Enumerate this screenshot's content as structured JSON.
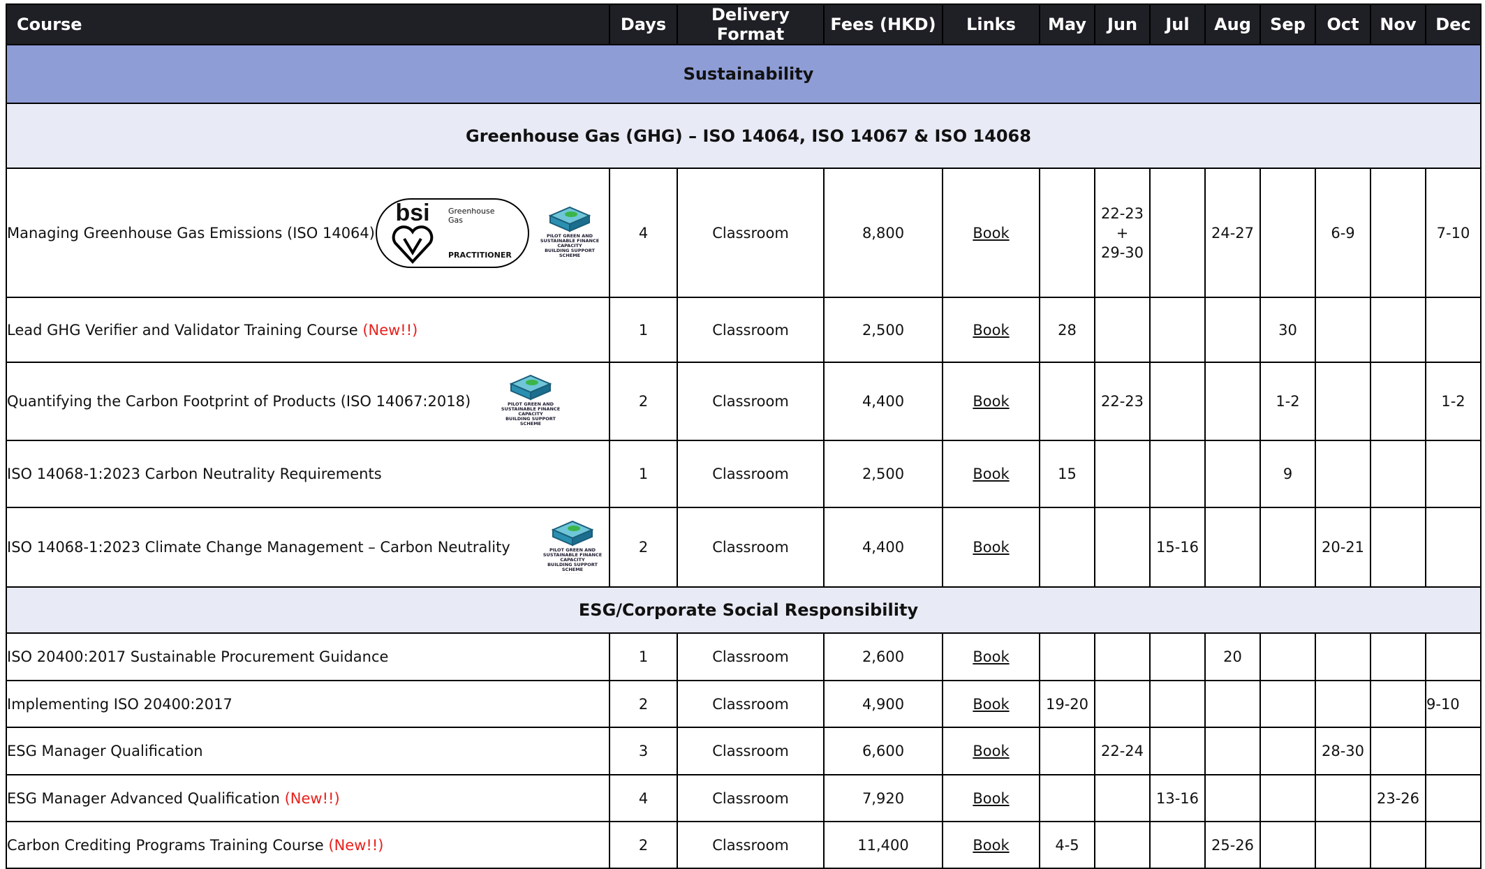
{
  "header": {
    "course": "Course",
    "days": "Days",
    "format": "Delivery Format",
    "fees": "Fees (HKD)",
    "links": "Links",
    "months": [
      "May",
      "Jun",
      "Jul",
      "Aug",
      "Sep",
      "Oct",
      "Nov",
      "Dec"
    ]
  },
  "section_title": "Sustainability",
  "subsection_ghg": "Greenhouse Gas (GHG) – ISO 14064, ISO 14067 & ISO 14068",
  "subsection_esg": "ESG/Corporate Social Responsibility",
  "logos": {
    "bsi_word": "bsi",
    "bsi_line1": "Greenhouse",
    "bsi_line2": "Gas",
    "bsi_practitioner": "PRACTITIONER",
    "gf_line1": "PILOT GREEN AND",
    "gf_line2": "SUSTAINABLE FINANCE CAPACITY",
    "gf_line3": "BUILDING SUPPORT SCHEME"
  },
  "ghg_rows": [
    {
      "name": "Managing Greenhouse Gas Emissions (ISO 14064)",
      "new": "",
      "days": "4",
      "format": "Classroom",
      "fee": "8,800",
      "link": "Book",
      "may": "",
      "jun": "22-23\n+\n29-30",
      "jul": "",
      "aug": "24-27",
      "sep": "",
      "oct": "6-9",
      "nov": "",
      "dec": "7-10"
    },
    {
      "name": "Lead GHG Verifier and Validator Training Course",
      "new": "(New!!)",
      "days": "1",
      "format": "Classroom",
      "fee": "2,500",
      "link": "Book",
      "may": "28",
      "jun": "",
      "jul": "",
      "aug": "",
      "sep": "30",
      "oct": "",
      "nov": "",
      "dec": ""
    },
    {
      "name": "Quantifying the Carbon Footprint of Products (ISO 14067:2018)",
      "new": "",
      "days": "2",
      "format": "Classroom",
      "fee": "4,400",
      "link": "Book",
      "may": "",
      "jun": "22-23",
      "jul": "",
      "aug": "",
      "sep": "1-2",
      "oct": "",
      "nov": "",
      "dec": "1-2"
    },
    {
      "name": "ISO 14068-1:2023 Carbon Neutrality Requirements",
      "new": "",
      "days": "1",
      "format": "Classroom",
      "fee": "2,500",
      "link": "Book",
      "may": "15",
      "jun": "",
      "jul": "",
      "aug": "",
      "sep": "9",
      "oct": "",
      "nov": "",
      "dec": ""
    },
    {
      "name": "ISO 14068-1:2023 Climate Change Management – Carbon Neutrality",
      "new": "",
      "days": "2",
      "format": "Classroom",
      "fee": "4,400",
      "link": "Book",
      "may": "",
      "jun": "",
      "jul": "15-16",
      "aug": "",
      "sep": "",
      "oct": "20-21",
      "nov": "",
      "dec": ""
    }
  ],
  "esg_rows": [
    {
      "name": "ISO 20400:2017 Sustainable Procurement Guidance",
      "new": "",
      "days": "1",
      "format": "Classroom",
      "fee": "2,600",
      "link": "Book",
      "may": "",
      "jun": "",
      "jul": "",
      "aug": "20",
      "sep": "",
      "oct": "",
      "nov": "",
      "dec": ""
    },
    {
      "name": "Implementing ISO 20400:2017",
      "new": "",
      "days": "2",
      "format": "Classroom",
      "fee": "4,900",
      "link": "Book",
      "may": "19-20",
      "jun": "",
      "jul": "",
      "aug": "",
      "sep": "",
      "oct": "",
      "nov": "",
      "dec": "9-10"
    },
    {
      "name": "ESG Manager Qualification",
      "new": "",
      "days": "3",
      "format": "Classroom",
      "fee": "6,600",
      "link": "Book",
      "may": "",
      "jun": "22-24",
      "jul": "",
      "aug": "",
      "sep": "",
      "oct": "28-30",
      "nov": "",
      "dec": ""
    },
    {
      "name": "ESG Manager Advanced Qualification",
      "new": "(New!!)",
      "days": "4",
      "format": "Classroom",
      "fee": "7,920",
      "link": "Book",
      "may": "",
      "jun": "",
      "jul": "13-16",
      "aug": "",
      "sep": "",
      "oct": "",
      "nov": "23-26",
      "dec": ""
    },
    {
      "name": "Carbon Crediting Programs Training Course",
      "new": "(New!!)",
      "days": "2",
      "format": "Classroom",
      "fee": "11,400",
      "link": "Book",
      "may": "4-5",
      "jun": "",
      "jul": "",
      "aug": "25-26",
      "sep": "",
      "oct": "",
      "nov": "",
      "dec": ""
    }
  ]
}
